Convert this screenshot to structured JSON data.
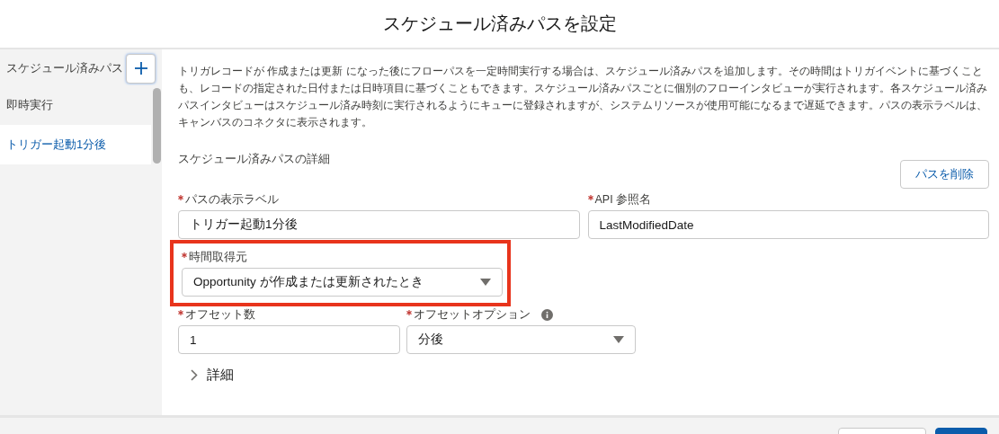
{
  "dialog": {
    "title": "スケジュール済みパスを設定"
  },
  "sidebar": {
    "heading": "スケジュール済みパス",
    "items": [
      {
        "label": "即時実行",
        "selected": false
      },
      {
        "label": "トリガー起動1分後",
        "selected": true
      }
    ]
  },
  "description": "トリガレコードが 作成または更新 になった後にフローパスを一定時間実行する場合は、スケジュール済みパスを追加します。その時間はトリガイベントに基づくことも、レコードの指定された日付または日時項目に基づくこともできます。スケジュール済みパスごとに個別のフローインタビューが実行されます。各スケジュール済みパスインタビューはスケジュール済み時刻に実行されるようにキューに登録されますが、システムリソースが使用可能になるまで遅延できます。パスの表示ラベルは、キャンバスのコネクタに表示されます。",
  "section_title": "スケジュール済みパスの詳細",
  "delete_button": "パスを削除",
  "field_rows": [
    [
      {
        "kind": "text",
        "label": "パスの表示ラベル",
        "required": true,
        "value": "トリガー起動1分後"
      },
      {
        "kind": "text",
        "label": "API 参照名",
        "required": true,
        "value": "LastModifiedDate"
      }
    ],
    [
      {
        "kind": "select",
        "label": "時間取得元",
        "required": true,
        "highlighted": true,
        "value": "Opportunity が作成または更新されたとき"
      }
    ],
    [
      {
        "kind": "text",
        "label": "オフセット数",
        "required": true,
        "value": "1"
      },
      {
        "kind": "select",
        "label": "オフセットオプション",
        "required": true,
        "info": true,
        "value": "分後"
      }
    ]
  ],
  "advanced": {
    "label": "詳細",
    "expanded": false
  }
}
